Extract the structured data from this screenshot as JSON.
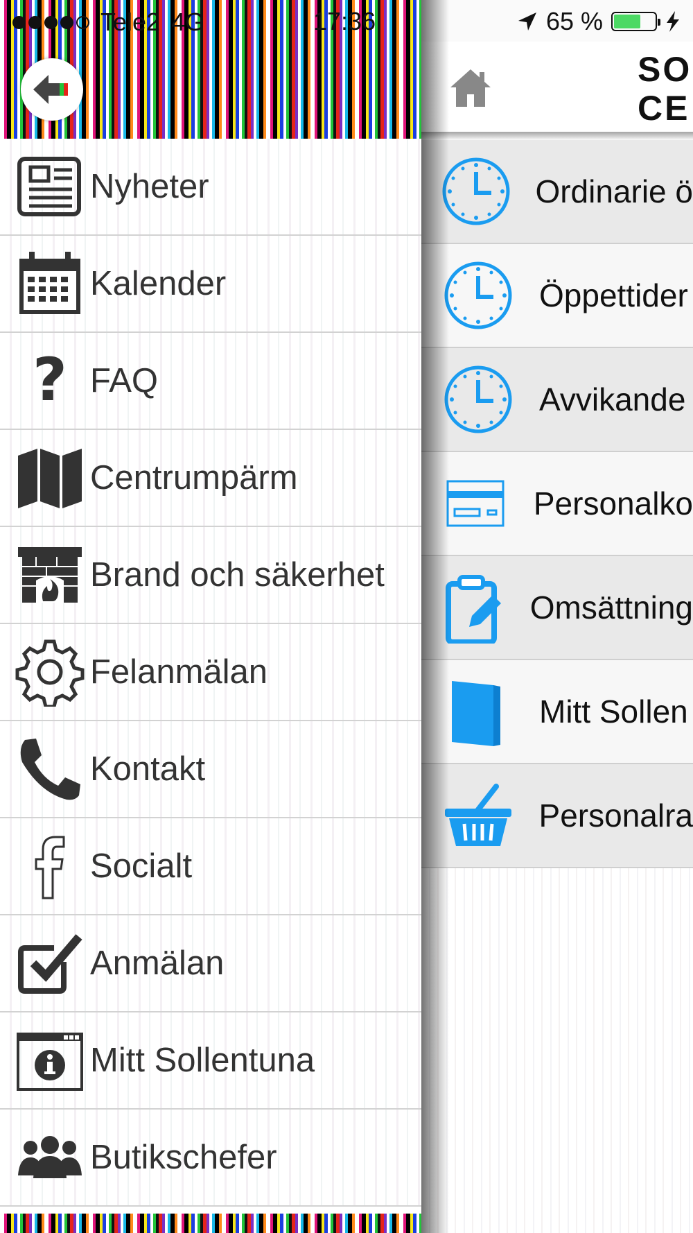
{
  "status_bar": {
    "carrier": "Tele2",
    "network": "4G",
    "time": "17:36",
    "battery": "65 %",
    "battery_level": 0.65
  },
  "drawer": {
    "items": [
      {
        "label": "Nyheter",
        "icon": "newspaper-icon"
      },
      {
        "label": "Kalender",
        "icon": "calendar-icon"
      },
      {
        "label": "FAQ",
        "icon": "question-icon"
      },
      {
        "label": "Centrumpärm",
        "icon": "map-icon"
      },
      {
        "label": "Brand och säkerhet",
        "icon": "fireplace-icon"
      },
      {
        "label": "Felanmälan",
        "icon": "gear-icon"
      },
      {
        "label": "Kontakt",
        "icon": "phone-icon"
      },
      {
        "label": "Socialt",
        "icon": "facebook-icon"
      },
      {
        "label": "Anmälan",
        "icon": "checkbox-icon"
      },
      {
        "label": "Mitt Sollentuna",
        "icon": "info-window-icon"
      },
      {
        "label": "Butikschefer",
        "icon": "group-icon"
      }
    ]
  },
  "header": {
    "title": "SO\nCE"
  },
  "main": {
    "accent_color": "#1a9cf0",
    "items": [
      {
        "label": "Ordinarie ö",
        "icon": "clock-icon"
      },
      {
        "label": "Öppettider",
        "icon": "clock-icon"
      },
      {
        "label": "Avvikande",
        "icon": "clock-icon"
      },
      {
        "label": "Personalko",
        "icon": "card-icon"
      },
      {
        "label": "Omsättning",
        "icon": "clipboard-icon"
      },
      {
        "label": "Mitt Sollen",
        "icon": "book-icon"
      },
      {
        "label": "Personalra",
        "icon": "basket-icon"
      }
    ]
  }
}
